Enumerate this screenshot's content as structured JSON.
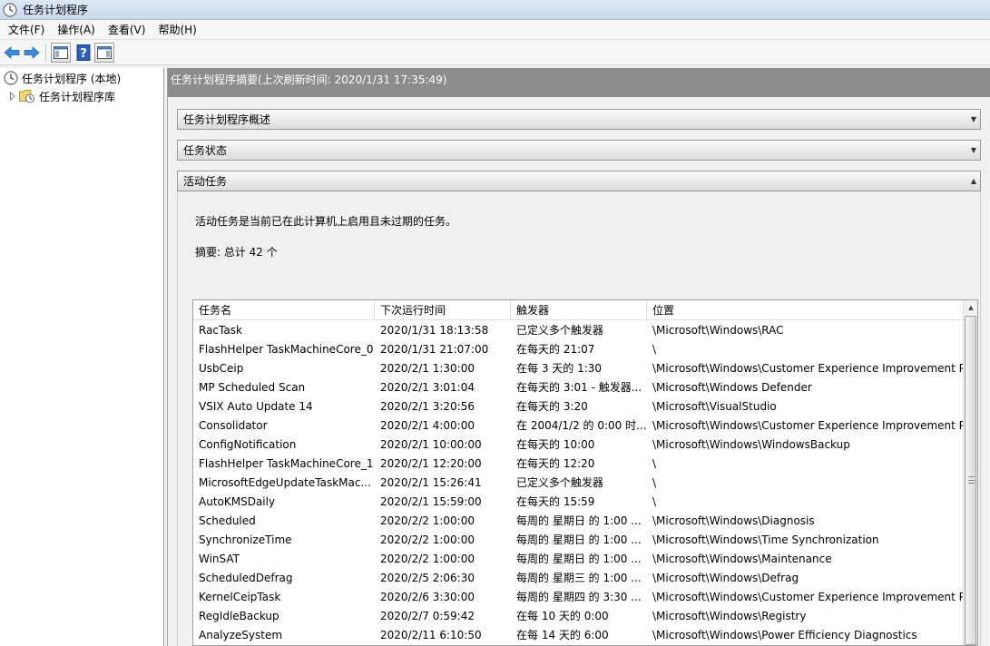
{
  "window": {
    "title": "任务计划程序"
  },
  "menu": [
    "文件(F)",
    "操作(A)",
    "查看(V)",
    "帮助(H)"
  ],
  "toolbar": {
    "icons": [
      "back-arrow-icon",
      "forward-arrow-icon",
      "show-hide-console-tree-icon",
      "help-icon",
      "show-hide-action-pane-icon"
    ]
  },
  "tree": {
    "root_label": "任务计划程序 (本地)",
    "child_label": "任务计划程序库"
  },
  "summary_header": "任务计划程序摘要(上次刷新时间: 2020/1/31 17:35:49)",
  "sections": {
    "overview": "任务计划程序概述",
    "status": "任务状态",
    "active": "活动任务"
  },
  "active_tasks": {
    "description": "活动任务是当前已在此计算机上启用且未过期的任务。",
    "summary": "摘要: 总计 42 个",
    "columns": [
      "任务名",
      "下次运行时间",
      "触发器",
      "位置"
    ],
    "rows": [
      [
        "RacTask",
        "2020/1/31 18:13:58",
        "已定义多个触发器",
        "\\Microsoft\\Windows\\RAC"
      ],
      [
        "FlashHelper TaskMachineCore_0",
        "2020/1/31 21:07:00",
        "在每天的 21:07",
        "\\"
      ],
      [
        "UsbCeip",
        "2020/2/1 1:30:00",
        "在每 3 天的 1:30",
        "\\Microsoft\\Windows\\Customer Experience Improvement P"
      ],
      [
        "MP Scheduled Scan",
        "2020/2/1 3:01:04",
        "在每天的 3:01 - 触发器...",
        "\\Microsoft\\Windows Defender"
      ],
      [
        "VSIX Auto Update 14",
        "2020/2/1 3:20:56",
        "在每天的 3:20",
        "\\Microsoft\\VisualStudio"
      ],
      [
        "Consolidator",
        "2020/2/1 4:00:00",
        "在 2004/1/2 的 0:00 时...",
        "\\Microsoft\\Windows\\Customer Experience Improvement P"
      ],
      [
        "ConfigNotification",
        "2020/2/1 10:00:00",
        "在每天的 10:00",
        "\\Microsoft\\Windows\\WindowsBackup"
      ],
      [
        "FlashHelper TaskMachineCore_1",
        "2020/2/1 12:20:00",
        "在每天的 12:20",
        "\\"
      ],
      [
        "MicrosoftEdgeUpdateTaskMac...",
        "2020/2/1 15:26:41",
        "已定义多个触发器",
        "\\"
      ],
      [
        "AutoKMSDaily",
        "2020/2/1 15:59:00",
        "在每天的 15:59",
        "\\"
      ],
      [
        "Scheduled",
        "2020/2/2 1:00:00",
        "每周的 星期日 的 1:00 ...",
        "\\Microsoft\\Windows\\Diagnosis"
      ],
      [
        "SynchronizeTime",
        "2020/2/2 1:00:00",
        "每周的 星期日 的 1:00 ...",
        "\\Microsoft\\Windows\\Time Synchronization"
      ],
      [
        "WinSAT",
        "2020/2/2 1:00:00",
        "每周的 星期日 的 1:00 ...",
        "\\Microsoft\\Windows\\Maintenance"
      ],
      [
        "ScheduledDefrag",
        "2020/2/5 2:06:30",
        "每周的 星期三 的 1:00 ...",
        "\\Microsoft\\Windows\\Defrag"
      ],
      [
        "KernelCeipTask",
        "2020/2/6 3:30:00",
        "每周的 星期四 的 3:30 ...",
        "\\Microsoft\\Windows\\Customer Experience Improvement P"
      ],
      [
        "RegIdleBackup",
        "2020/2/7 0:59:42",
        "在每 10 天的 0:00",
        "\\Microsoft\\Windows\\Registry"
      ],
      [
        "AnalyzeSystem",
        "2020/2/11 6:10:50",
        "在每 14 天的 6:00",
        "\\Microsoft\\Windows\\Power Efficiency Diagnostics"
      ]
    ]
  }
}
